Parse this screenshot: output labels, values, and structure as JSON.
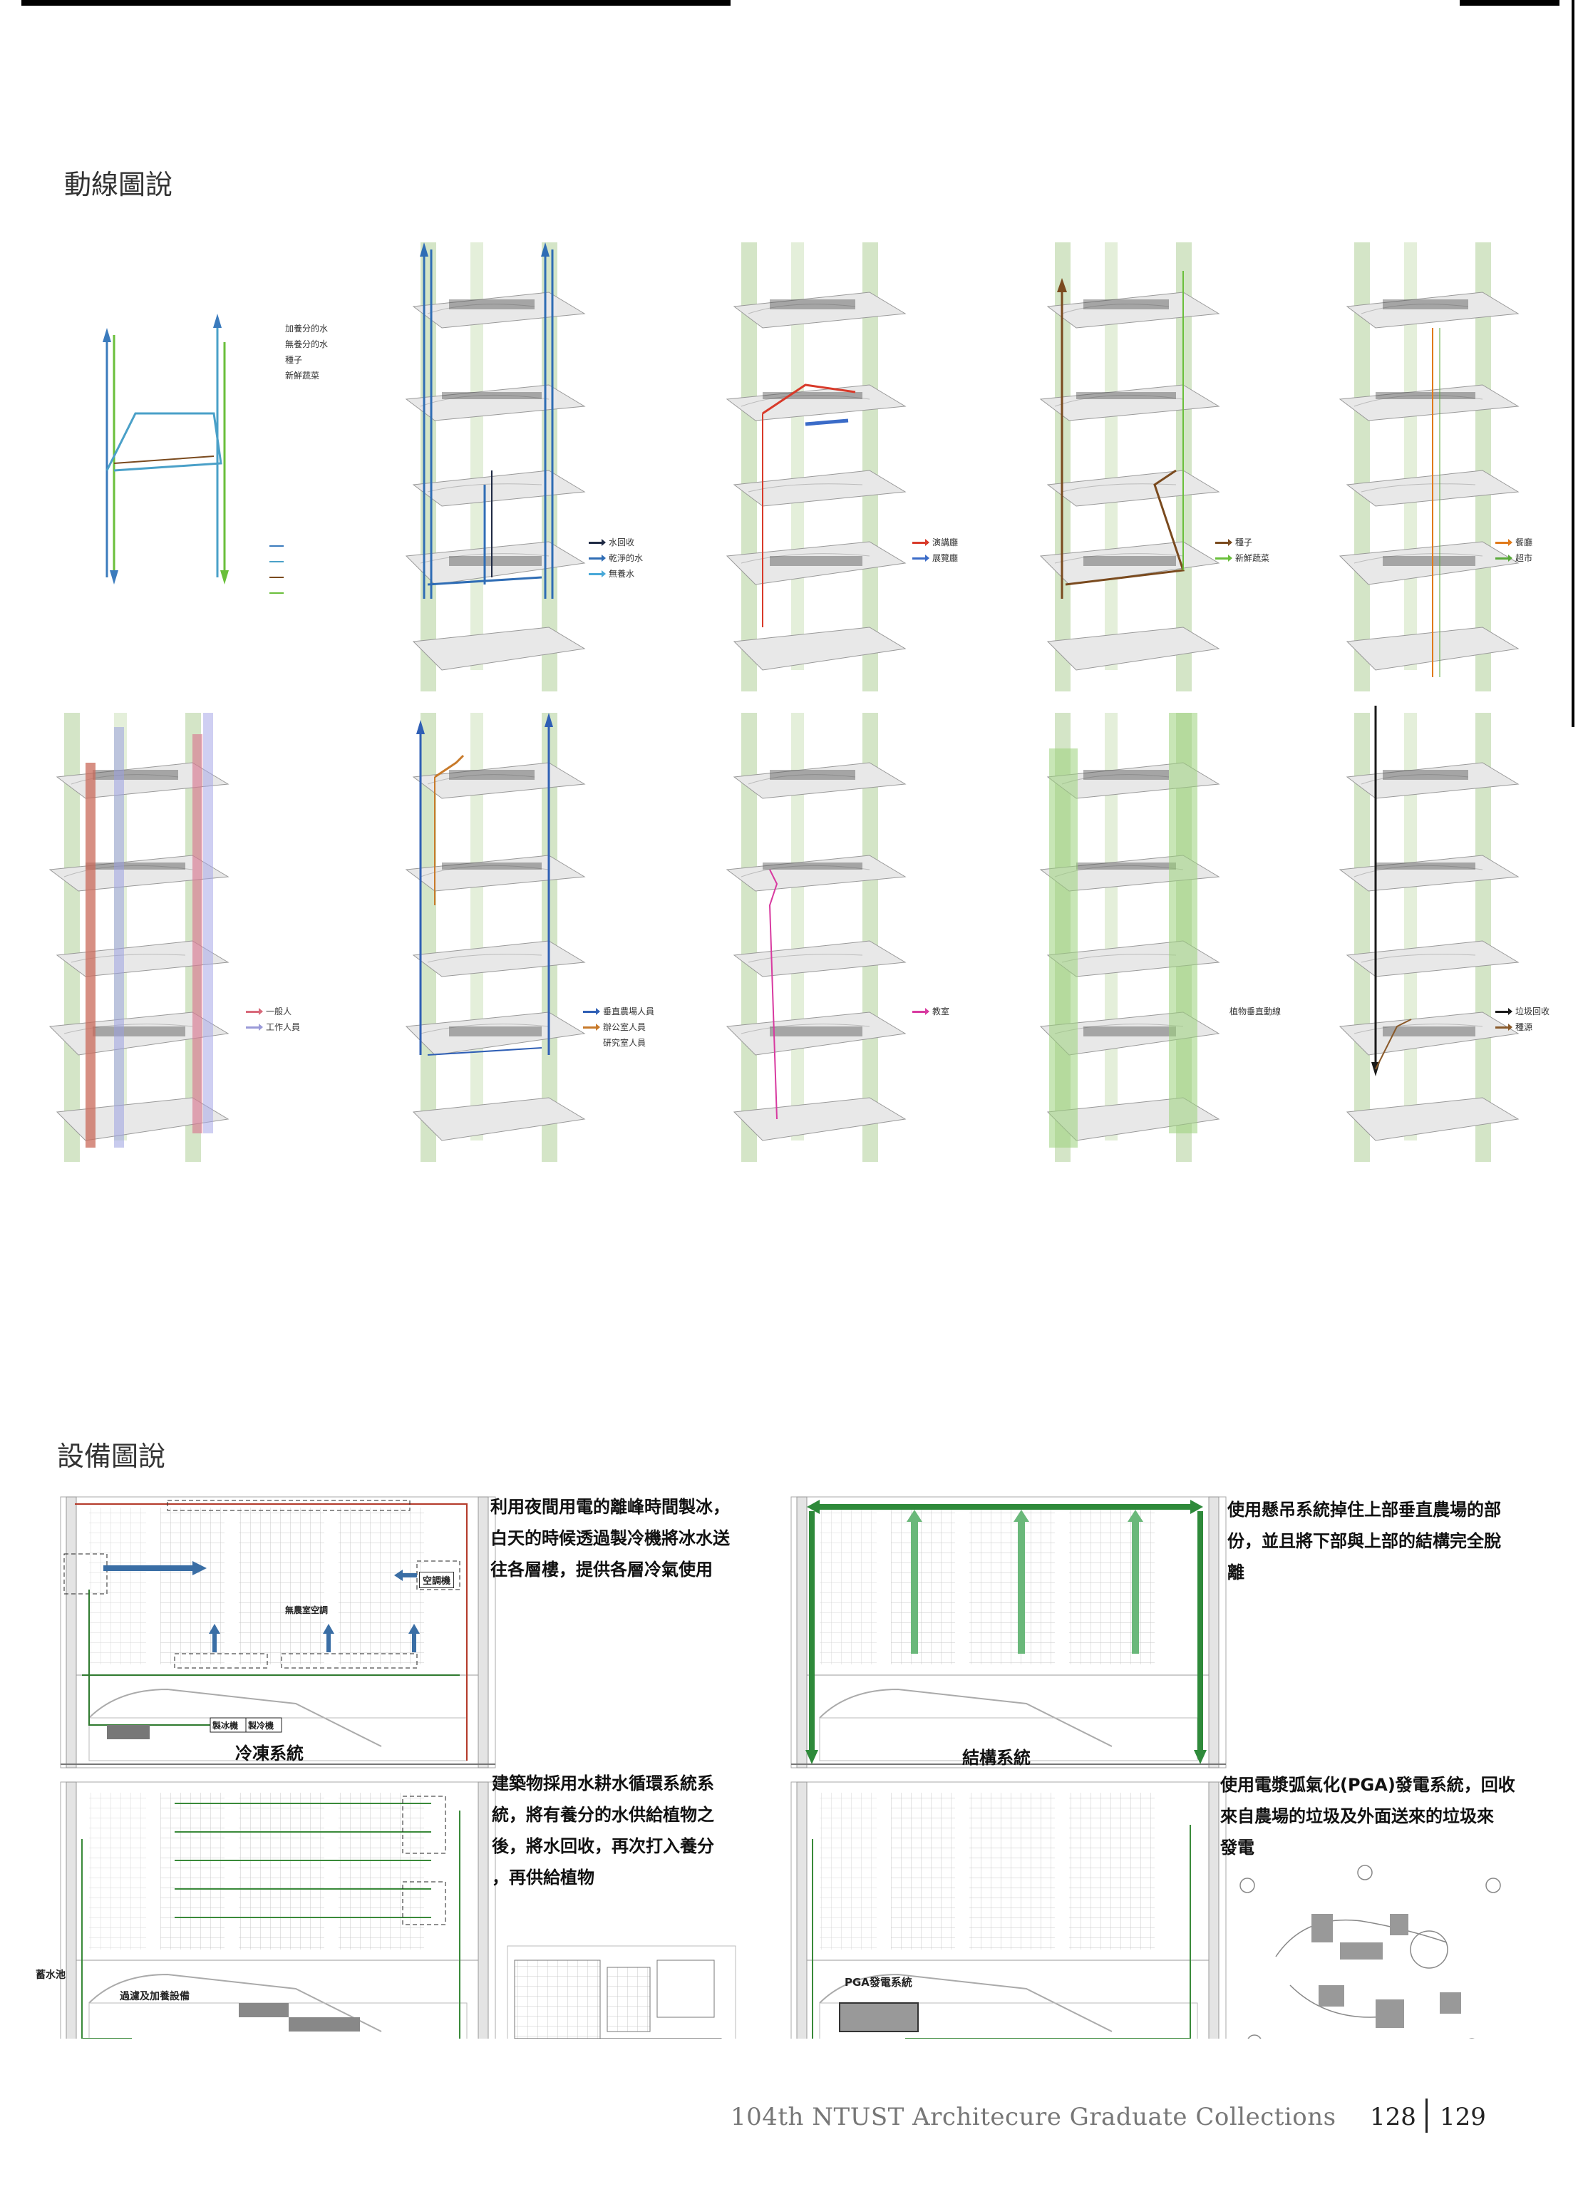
{
  "section1": {
    "title": "動線圖說"
  },
  "section2": {
    "title": "設備圖說"
  },
  "diagrams_row1": [
    {
      "legend": [
        {
          "label": "加養分的水",
          "color": "#3b7bbd"
        },
        {
          "label": "無養分的水",
          "color": "#4aa0c8"
        },
        {
          "label": "種子",
          "color": "#7a4a1e"
        },
        {
          "label": "新鮮蔬菜",
          "color": "#6abf3b"
        }
      ]
    },
    {
      "legend": [
        {
          "label": "水回收",
          "color": "#1f2a44"
        },
        {
          "label": "乾淨的水",
          "color": "#2f6db5"
        },
        {
          "label": "無養水",
          "color": "#48a8d8"
        }
      ]
    },
    {
      "legend": [
        {
          "label": "演講廳",
          "color": "#d83a2a"
        },
        {
          "label": "展覽廳",
          "color": "#3a6bc8"
        }
      ]
    },
    {
      "legend": [
        {
          "label": "種子",
          "color": "#7a4a1e"
        },
        {
          "label": "新鮮蔬菜",
          "color": "#6abf3b"
        }
      ]
    },
    {
      "legend": [
        {
          "label": "餐廳",
          "color": "#e07a1a"
        },
        {
          "label": "超市",
          "color": "#5aaa3a"
        }
      ]
    }
  ],
  "diagrams_row2": [
    {
      "legend": [
        {
          "label": "一般人",
          "color": "#d8697a"
        },
        {
          "label": "工作人員",
          "color": "#9a9ad8"
        }
      ]
    },
    {
      "legend": [
        {
          "label": "垂直農場人員",
          "color": "#2f5fb5"
        },
        {
          "label": "辦公室人員",
          "color": "#c87a2a"
        },
        {
          "label": "研究室人員",
          "color": "#ffffff"
        }
      ]
    },
    {
      "legend": [
        {
          "label": "教室",
          "color": "#d83aa0"
        }
      ]
    },
    {
      "legend": [
        {
          "label": "植物垂直動線",
          "color": "#ffffff"
        }
      ]
    },
    {
      "legend": [
        {
          "label": "垃圾回收",
          "color": "#1a1a1a"
        },
        {
          "label": "種源",
          "color": "#8a5a2a"
        }
      ]
    }
  ],
  "equipment": {
    "cooling": {
      "caption": "冷凍系統",
      "desc_lines": [
        "利用夜間用電的離峰時間製冰，",
        "白天的時候透過製冷機將冰水送",
        "往各層樓，提供各層冷氣使用"
      ],
      "labels": {
        "ac": "空調機",
        "farm_ac": "無農室空調",
        "icemaker": "製冰機",
        "chiller": "製冷機"
      }
    },
    "structure": {
      "caption": "結構系統",
      "desc_lines": [
        "使用懸吊系統掉住上部垂直農場的部",
        "份，並且將下部與上部的結構完全脫",
        "離"
      ]
    },
    "water": {
      "desc_lines": [
        "建築物採用水耕水循環系統系",
        "統，將有養分的水供給植物之",
        "後，將水回收，再次打入養分",
        "，再供給植物"
      ],
      "labels": {
        "tank": "蓄水池",
        "filter": "過濾及加養設備"
      }
    },
    "pga": {
      "desc_lines": [
        "使用電漿弧氣化(PGA)發電系統，回收",
        "來自農場的垃圾及外面送來的垃圾來",
        "發電"
      ],
      "labels": {
        "pga_system": "PGA發電系統"
      }
    }
  },
  "footer": {
    "text": "104th NTUST Architecure Graduate Collections",
    "page_left": "128",
    "page_right": "129"
  }
}
